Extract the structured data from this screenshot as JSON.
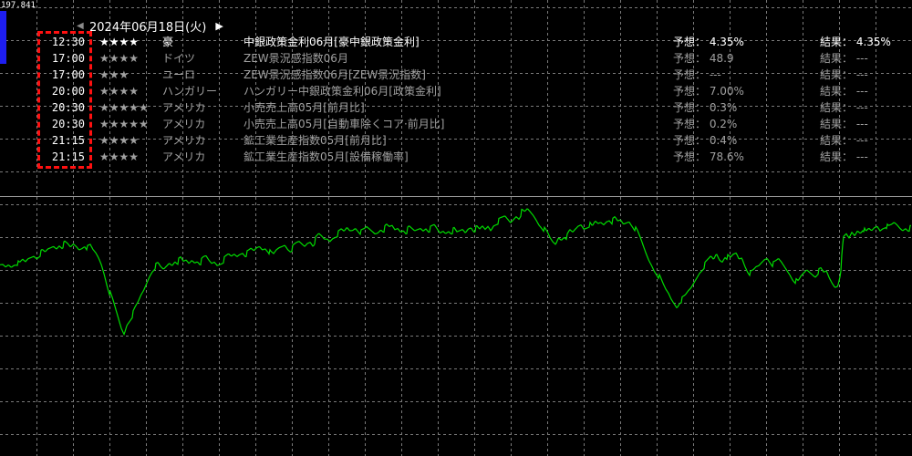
{
  "price_label": "197.841",
  "date_nav": {
    "prev_icon": "triangle-left-icon",
    "next_icon": "triangle-right-icon",
    "date": "2024年06月18日(火)"
  },
  "events": [
    {
      "time": "12:30",
      "stars": "★★★★",
      "country": "豪",
      "title": "中銀政策金利06月[豪中銀政策金利]",
      "forecast": "予想： 4.35%",
      "result": "結果： 4.35%",
      "published": true
    },
    {
      "time": "17:00",
      "stars": "★★★★",
      "country": "ドイツ",
      "title": "ZEW景況感指数06月",
      "forecast": "予想： 48.9",
      "result": "結果： ---",
      "published": false
    },
    {
      "time": "17:00",
      "stars": "★★★",
      "country": "ユーロ",
      "title": "ZEW景況感指数06月[ZEW景況指数]",
      "forecast": "予想： ---",
      "result": "結果： ---",
      "published": false
    },
    {
      "time": "20:00",
      "stars": "★★★★",
      "country": "ハンガリー",
      "title": "ハンガリー中銀政策金利06月[政策金利]",
      "forecast": "予想： 7.00%",
      "result": "結果： ---",
      "published": false
    },
    {
      "time": "20:30",
      "stars": "★★★★★",
      "country": "アメリカ",
      "title": "小売売上高05月[前月比]",
      "forecast": "予想： 0.3%",
      "result": "結果： ---",
      "published": false
    },
    {
      "time": "20:30",
      "stars": "★★★★★",
      "country": "アメリカ",
      "title": "小売売上高05月[自動車除くコア·前月比]",
      "forecast": "予想： 0.2%",
      "result": "結果： ---",
      "published": false
    },
    {
      "time": "21:15",
      "stars": "★★★★",
      "country": "アメリカ",
      "title": "鉱工業生産指数05月[前月比]",
      "forecast": "予想： 0.4%",
      "result": "結果： ---",
      "published": false
    },
    {
      "time": "21:15",
      "stars": "★★★★",
      "country": "アメリカ",
      "title": "鉱工業生産指数05月[設備稼働率]",
      "forecast": "予想： 78.6%",
      "result": "結果： ---",
      "published": false
    }
  ],
  "colors": {
    "background": "#000000",
    "line": "#00dd00",
    "grid": "#7a7a7a",
    "highlight_box": "#ff1010",
    "side_bar": "#1e1ef0",
    "text_bright": "#ffffff",
    "text_dim": "#a0a0a0"
  },
  "chart_data": {
    "type": "line",
    "title": "",
    "xlabel": "",
    "ylabel": "",
    "series": [
      {
        "values": [
          292,
          291,
          293,
          290,
          292,
          289,
          288,
          290,
          286,
          288,
          284,
          282,
          280,
          282,
          279,
          276,
          278,
          274,
          272,
          270,
          272,
          268,
          270,
          267,
          269,
          272,
          268,
          270,
          273,
          271,
          268,
          272,
          270,
          275,
          278,
          283,
          290,
          300,
          312,
          322,
          330,
          340,
          350,
          360,
          366,
          355,
          350,
          345,
          338,
          332,
          324,
          318,
          310,
          302,
          296,
          292,
          290,
          294,
          296,
          292,
          288,
          290,
          285,
          287,
          284,
          288,
          286,
          289,
          285,
          287,
          285,
          288,
          284,
          282,
          286,
          289,
          287,
          290,
          288,
          286,
          283,
          280,
          282,
          279,
          281,
          278,
          276,
          279,
          277,
          274,
          276,
          272,
          270,
          273,
          271,
          274,
          278,
          280,
          275,
          272,
          270,
          268,
          272,
          274,
          271,
          268,
          266,
          268,
          270,
          266,
          264,
          268,
          262,
          258,
          260,
          263,
          262,
          264,
          260,
          258,
          256,
          253,
          255,
          250,
          253,
          252,
          249,
          252,
          255,
          253,
          250,
          252,
          254,
          256,
          254,
          250,
          252,
          248,
          250,
          248,
          252,
          250,
          253,
          251,
          254,
          250,
          252,
          254,
          252,
          250,
          252,
          249,
          252,
          250,
          248,
          252,
          256,
          253,
          255,
          252,
          254,
          252,
          256,
          254,
          252,
          255,
          250,
          248,
          252,
          250,
          253,
          249,
          252,
          248,
          252,
          246,
          244,
          242,
          240,
          238,
          241,
          244,
          240,
          236,
          238,
          232,
          234,
          230,
          233,
          236,
          240,
          245,
          248,
          252,
          256,
          262,
          266,
          268,
          260,
          262,
          258,
          260,
          254,
          256,
          252,
          248,
          246,
          250,
          248,
          246,
          250,
          244,
          246,
          244,
          246,
          242,
          240,
          243,
          240,
          244,
          242,
          246,
          244,
          242,
          246,
          250,
          255,
          262,
          270,
          278,
          285,
          290,
          296,
          300,
          305,
          312,
          318,
          322,
          328,
          332,
          336,
          330,
          328,
          325,
          320,
          316,
          310,
          304,
          298,
          294,
          290,
          286,
          282,
          285,
          278,
          284,
          286,
          280,
          282,
          284,
          280,
          278,
          284,
          282,
          290,
          296,
          300,
          298,
          294,
          292,
          288,
          284,
          282,
          286,
          290,
          288,
          285,
          288,
          292,
          296,
          300,
          305,
          308,
          310,
          304,
          300,
          296,
          298,
          300,
          302,
          298,
          296,
          300,
          298,
          305,
          310,
          314,
          312,
          298,
          262,
          258,
          262,
          255,
          258,
          252,
          254,
          250,
          256,
          252,
          254,
          250,
          248,
          252,
          249,
          247,
          250,
          248,
          245,
          247,
          250,
          252,
          249,
          251,
          250
        ]
      }
    ],
    "x_range": [
      0,
      999
    ],
    "y_domain_pixels_note": "",
    "grid": true
  }
}
